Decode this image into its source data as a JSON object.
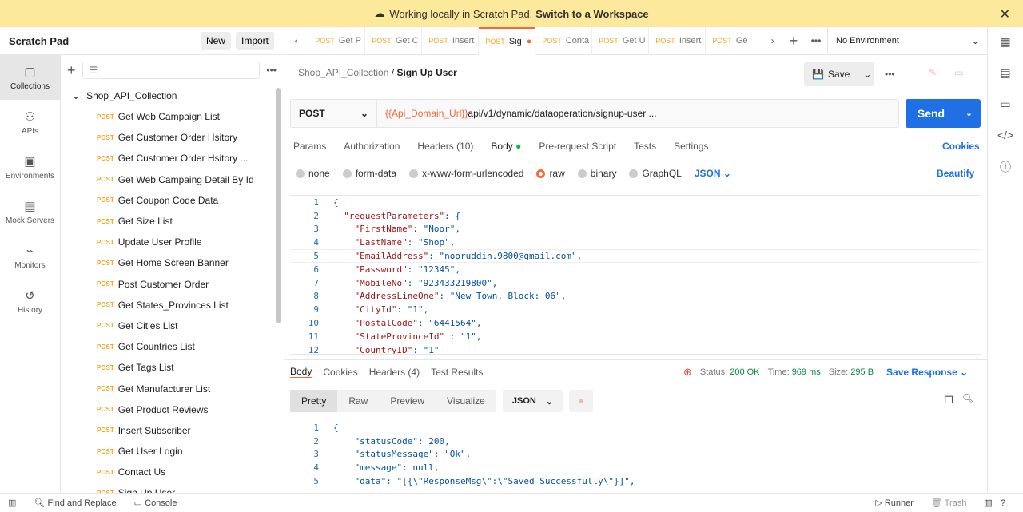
{
  "banner": {
    "text": "Working locally in Scratch Pad.",
    "link": "Switch to a Workspace"
  },
  "sidebar": {
    "title": "Scratch Pad",
    "new_label": "New",
    "import_label": "Import",
    "rail": [
      {
        "label": "Collections",
        "icon": "collections-icon"
      },
      {
        "label": "APIs",
        "icon": "apis-icon"
      },
      {
        "label": "Environments",
        "icon": "environments-icon"
      },
      {
        "label": "Mock Servers",
        "icon": "mock-servers-icon"
      },
      {
        "label": "Monitors",
        "icon": "monitors-icon"
      },
      {
        "label": "History",
        "icon": "history-icon"
      }
    ],
    "collection": "Shop_API_Collection",
    "requests": [
      {
        "method": "POST",
        "name": "Get Web Campaign List"
      },
      {
        "method": "POST",
        "name": "Get Customer Order Hsitory"
      },
      {
        "method": "POST",
        "name": "Get Customer Order Hsitory ..."
      },
      {
        "method": "POST",
        "name": "Get Web Campaing Detail By Id"
      },
      {
        "method": "POST",
        "name": "Get Coupon Code Data"
      },
      {
        "method": "POST",
        "name": "Get Size List"
      },
      {
        "method": "POST",
        "name": "Update User Profile"
      },
      {
        "method": "POST",
        "name": "Get Home Screen Banner"
      },
      {
        "method": "POST",
        "name": "Post Customer Order"
      },
      {
        "method": "POST",
        "name": "Get States_Provinces List"
      },
      {
        "method": "POST",
        "name": "Get Cities List"
      },
      {
        "method": "POST",
        "name": "Get Countries List"
      },
      {
        "method": "POST",
        "name": "Get Tags List"
      },
      {
        "method": "POST",
        "name": "Get Manufacturer List"
      },
      {
        "method": "POST",
        "name": "Get Product Reviews"
      },
      {
        "method": "POST",
        "name": "Insert Subscriber"
      },
      {
        "method": "POST",
        "name": "Get User Login"
      },
      {
        "method": "POST",
        "name": "Contact Us"
      },
      {
        "method": "POST",
        "name": "Sign Up User"
      }
    ]
  },
  "tabs": [
    {
      "method": "POST",
      "name": "Get P"
    },
    {
      "method": "POST",
      "name": "Get C"
    },
    {
      "method": "POST",
      "name": "Insert"
    },
    {
      "method": "POST",
      "name": "Sig",
      "active": true
    },
    {
      "method": "POST",
      "name": "Conta"
    },
    {
      "method": "POST",
      "name": "Get U"
    },
    {
      "method": "POST",
      "name": "Insert"
    },
    {
      "method": "POST",
      "name": "Ge"
    }
  ],
  "environment": "No Environment",
  "breadcrumb": {
    "parent": "Shop_API_Collection",
    "current": "Sign Up User"
  },
  "save_label": "Save",
  "request": {
    "method": "POST",
    "url_var": "{{Api_Domain_Url}}",
    "url_path": "api/v1/dynamic/dataoperation/signup-user ...",
    "send_label": "Send"
  },
  "req_tabs": [
    "Params",
    "Authorization",
    "Headers (10)",
    "Body",
    "Pre-request Script",
    "Tests",
    "Settings"
  ],
  "cookies_label": "Cookies",
  "body_types": [
    {
      "label": "none"
    },
    {
      "label": "form-data"
    },
    {
      "label": "x-www-form-urlencoded"
    },
    {
      "label": "raw",
      "selected": true
    },
    {
      "label": "binary"
    },
    {
      "label": "GraphQL"
    }
  ],
  "body_format": "JSON",
  "beautify_label": "Beautify",
  "body_lines": [
    [
      "",
      "{",
      ""
    ],
    [
      "  ",
      "\"requestParameters\"",
      ": {"
    ],
    [
      "    ",
      "\"FirstName\"",
      ": \"Noor\","
    ],
    [
      "    ",
      "\"LastName\"",
      ": \"Shop\","
    ],
    [
      "    ",
      "\"EmailAddress\"",
      ": \"nooruddin.9800@gmail.com\","
    ],
    [
      "    ",
      "\"Password\"",
      ": \"12345\","
    ],
    [
      "    ",
      "\"MobileNo\"",
      ": \"923433219800\","
    ],
    [
      "    ",
      "\"AddressLineOne\"",
      ": \"New Town, Block: 06\","
    ],
    [
      "    ",
      "\"CityId\"",
      ": \"1\","
    ],
    [
      "    ",
      "\"PostalCode\"",
      ": \"6441564\","
    ],
    [
      "    ",
      "\"StateProvinceId\"",
      " : \"1\","
    ],
    [
      "    ",
      "\"CountryID\"",
      ": \"1\""
    ]
  ],
  "response": {
    "tabs": [
      "Body",
      "Cookies",
      "Headers (4)",
      "Test Results"
    ],
    "status": "200 OK",
    "time": "969 ms",
    "size": "295 B",
    "status_label": "Status:",
    "time_label": "Time:",
    "size_label": "Size:",
    "save_label": "Save Response",
    "views": [
      "Pretty",
      "Raw",
      "Preview",
      "Visualize"
    ],
    "format": "JSON",
    "lines": [
      "{",
      "    \"statusCode\": 200,",
      "    \"statusMessage\": \"Ok\",",
      "    \"message\": null,",
      "    \"data\": \"[{\\\"ResponseMsg\\\":\\\"Saved Successfully\\\"}]\","
    ]
  },
  "footer": {
    "find": "Find and Replace",
    "console": "Console",
    "runner": "Runner",
    "trash": "Trash"
  }
}
